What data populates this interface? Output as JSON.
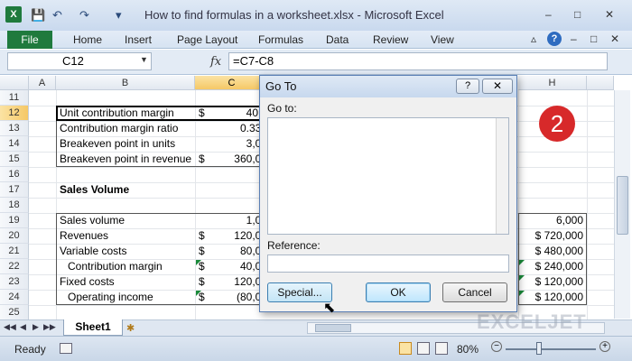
{
  "window": {
    "title": "How to find formulas in a worksheet.xlsx  -  Microsoft Excel",
    "app_badge": "X",
    "min_glyph": "–",
    "max_glyph": "□",
    "close_glyph": "✕"
  },
  "quick_access": {
    "save": "💾",
    "undo": "↶",
    "redo": "↷",
    "customize": "▾"
  },
  "ribbon": {
    "file_tab": "File",
    "tabs": [
      "Home",
      "Insert",
      "Page Layout",
      "Formulas",
      "Data",
      "Review",
      "View"
    ],
    "help": "?",
    "caret": "▵"
  },
  "formula_bar": {
    "name_box": "C12",
    "fx": "fx",
    "formula": "=C7-C8"
  },
  "grid": {
    "columns": [
      "A",
      "B",
      "C",
      "H"
    ],
    "rows": [
      "11",
      "12",
      "13",
      "14",
      "15",
      "16",
      "17",
      "18",
      "19",
      "20",
      "21",
      "22",
      "23",
      "24",
      "25"
    ],
    "cells": {
      "b12": "Unit contribution margin",
      "c12_sym": "$",
      "c12": "40.0",
      "b13": "Contribution margin ratio",
      "c13": "0.333",
      "b14": "Breakeven point in units",
      "c14": "3,00",
      "b15": "Breakeven point in revenue",
      "c15_sym": "$",
      "c15": "360,00",
      "b17": "Sales Volume",
      "b19": "Sales volume",
      "c19": "1,00",
      "h19": "6,000",
      "b20": "Revenues",
      "c20_sym": "$",
      "c20": "120,00",
      "h20": "$ 720,000",
      "b21": "Variable costs",
      "c21_sym": "$",
      "c21": "80,00",
      "h21": "$ 480,000",
      "b22": "Contribution margin",
      "c22_sym": "$",
      "c22": "40,00",
      "h22": "$ 240,000",
      "b23": "Fixed costs",
      "c23_sym": "$",
      "c23": "120,00",
      "h23": "$ 120,000",
      "b24": "Operating income",
      "c24_sym": "$",
      "c24": "(80,00",
      "h24": "$ 120,000"
    }
  },
  "sheet_tabs": {
    "active": "Sheet1",
    "nav": [
      "◀◀",
      "◀",
      "▶",
      "▶▶"
    ],
    "new_sheet_icon": "✱"
  },
  "status_bar": {
    "ready": "Ready",
    "zoom": "80%",
    "zoom_out": "−",
    "zoom_in": "+"
  },
  "badge": "2",
  "watermark": "EXCELJET",
  "dialog": {
    "title": "Go To",
    "help_glyph": "?",
    "close_glyph": "✕",
    "goto_label": "Go to:",
    "reference_label": "Reference:",
    "reference_value": "",
    "special_button": "Special...",
    "ok_button": "OK",
    "cancel_button": "Cancel"
  },
  "colors": {
    "excel_green": "#1f7a3d",
    "selection": "#f5c866",
    "badge_red": "#d7292a"
  }
}
